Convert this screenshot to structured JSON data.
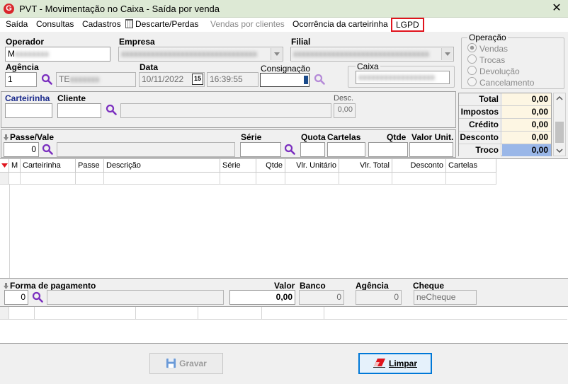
{
  "window": {
    "title": "PVT - Movimentação no Caixa - Saída por venda",
    "close": "✕",
    "logo": "G"
  },
  "menu": [
    {
      "label": "Saída",
      "disabled": false
    },
    {
      "label": "Consultas",
      "disabled": false
    },
    {
      "label": "Cadastros",
      "disabled": false
    },
    {
      "label": "Descarte/Perdas",
      "disabled": false
    },
    {
      "label": "Vendas por clientes",
      "disabled": true
    },
    {
      "label": "Ocorrência da carteirinha",
      "disabled": false
    },
    {
      "label": "LGPD",
      "disabled": false
    }
  ],
  "header": {
    "operador_label": "Operador",
    "operador_value": "M",
    "empresa_label": "Empresa",
    "empresa_value": "",
    "filial_label": "Filial",
    "filial_value": "",
    "agencia_label": "Agência",
    "agencia_value": "1",
    "agencia_name": "TE",
    "data_label": "Data",
    "data_value": "10/11/2022",
    "hora_value": "16:39:55",
    "cal_glyph": "15",
    "consignacao_label": "Consignação",
    "caixa_label": "Caixa",
    "caixa_value": ""
  },
  "operacao": {
    "title": "Operação",
    "options": [
      {
        "label": "Vendas",
        "checked": true
      },
      {
        "label": "Trocas",
        "checked": false
      },
      {
        "label": "Devolução",
        "checked": false
      },
      {
        "label": "Cancelamento",
        "checked": false
      }
    ]
  },
  "cliente": {
    "carteirinha_label": "Carteirinha",
    "cliente_label": "Cliente",
    "desc_label": "Desc.",
    "desc_value": "0,00"
  },
  "totals": [
    {
      "label": "Total",
      "value": "0,00"
    },
    {
      "label": "Impostos",
      "value": "0,00"
    },
    {
      "label": "Crédito",
      "value": "0,00"
    },
    {
      "label": "Desconto",
      "value": "0,00"
    },
    {
      "label": "Troco",
      "value": "0,00"
    }
  ],
  "passe": {
    "passe_label": "Passe/Vale",
    "passe_value": "0",
    "serie_label": "Série",
    "quota_label": "Quota",
    "cartelas_label": "Cartelas",
    "qtde_label": "Qtde",
    "valor_unit_label": "Valor Unit."
  },
  "items_grid": {
    "columns": [
      "M",
      "Carteirinha",
      "Passe",
      "Descrição",
      "Série",
      "Qtde",
      "Vlr. Unitário",
      "Vlr. Total",
      "Desconto",
      "Cartelas"
    ]
  },
  "pagamento": {
    "forma_label": "Forma de pagamento",
    "forma_value": "0",
    "valor_label": "Valor",
    "valor_value": "0,00",
    "banco_label": "Banco",
    "banco_value": "0",
    "agencia_label": "Agência",
    "agencia_value": "0",
    "cheque_label": "Cheque",
    "cheque_value": "neCheque"
  },
  "buttons": {
    "gravar": "Gravar",
    "limpar": "Limpar"
  },
  "colors": {
    "lgpd_border": "#e0141d",
    "troco_bg": "#9ab7e8",
    "search_icon": "#7b2fbf"
  }
}
